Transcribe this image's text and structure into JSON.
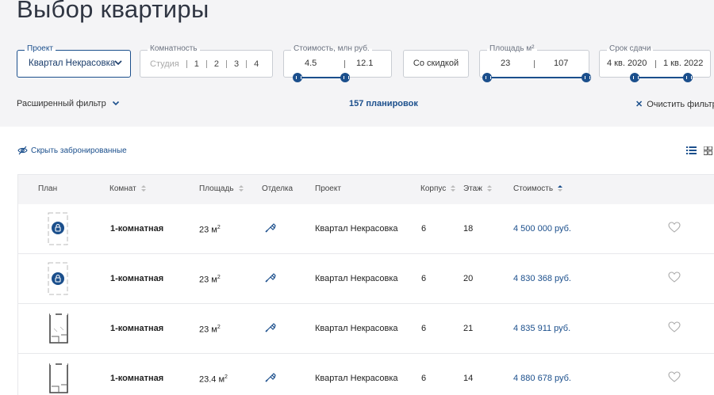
{
  "page": {
    "title": "Выбор квартиры"
  },
  "filters": {
    "project": {
      "label": "Проект",
      "value": "Квартал Некрасовка"
    },
    "rooms": {
      "label": "Комнатность",
      "options": [
        "Студия",
        "1",
        "2",
        "3",
        "4"
      ]
    },
    "price": {
      "label": "Стоимость, млн руб.",
      "min": "4.5",
      "max": "12.1"
    },
    "discount": {
      "label": "Со скидкой"
    },
    "area": {
      "label": "Площадь м²",
      "min": "23",
      "max": "107"
    },
    "deadline": {
      "label": "Срок сдачи",
      "min": "4 кв. 2020",
      "max": "1 кв. 2022"
    },
    "advanced": "Расширенный фильтр",
    "count": "157 планировок",
    "clear": "Очистить фильтр"
  },
  "toolbar": {
    "hide_reserved": "Скрыть забронированные"
  },
  "table": {
    "headers": {
      "plan": "План",
      "rooms": "Комнат",
      "area": "Площадь",
      "finish": "Отделка",
      "project": "Проект",
      "korpus": "Корпус",
      "floor": "Этаж",
      "price": "Стоимость"
    },
    "rows": [
      {
        "rooms": "1-комнатная",
        "area": "23 м",
        "area_unit": "2",
        "project": "Квартал Некрасовка",
        "korpus": "6",
        "floor": "18",
        "price": "4 500 000 руб.",
        "plan_type": "locked"
      },
      {
        "rooms": "1-комнатная",
        "area": "23 м",
        "area_unit": "2",
        "project": "Квартал Некрасовка",
        "korpus": "6",
        "floor": "20",
        "price": "4 830 368 руб.",
        "plan_type": "locked"
      },
      {
        "rooms": "1-комнатная",
        "area": "23 м",
        "area_unit": "2",
        "project": "Квартал Некрасовка",
        "korpus": "6",
        "floor": "21",
        "price": "4 835 911 руб.",
        "plan_type": "floorplan"
      },
      {
        "rooms": "1-комнатная",
        "area": "23.4 м",
        "area_unit": "2",
        "project": "Квартал Некрасовка",
        "korpus": "6",
        "floor": "14",
        "price": "4 880 678 руб.",
        "plan_type": "floorplan"
      }
    ]
  },
  "colors": {
    "accent": "#1b4f8c",
    "panel_bg": "#f4f4f6"
  }
}
